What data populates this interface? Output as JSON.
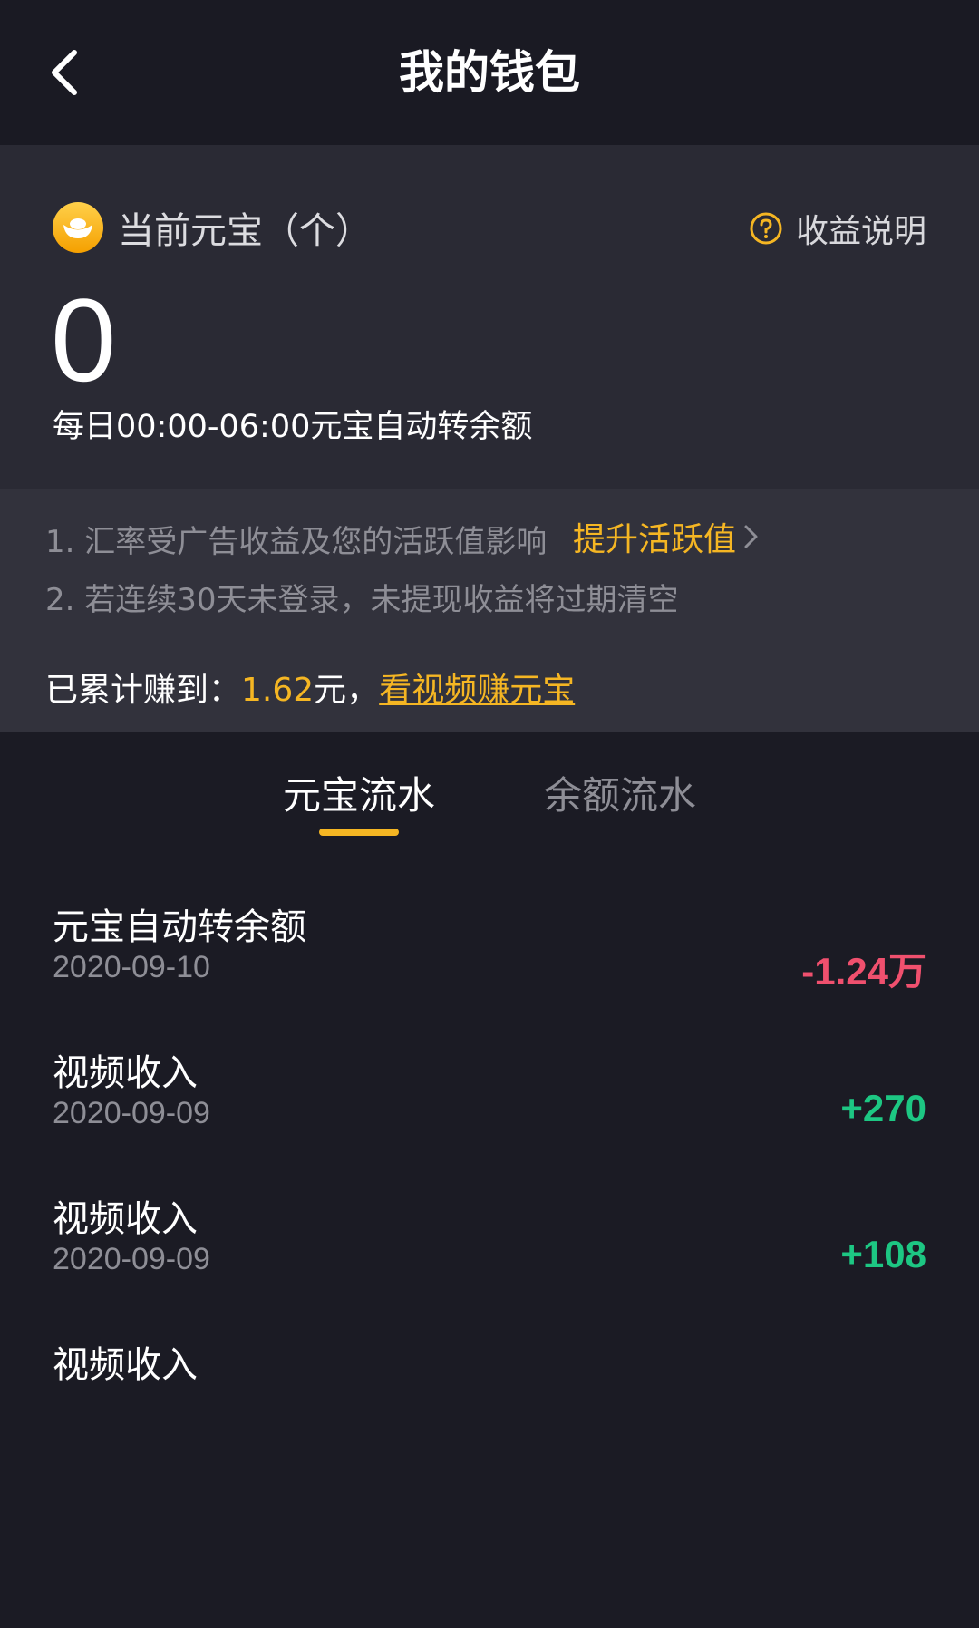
{
  "header": {
    "title": "我的钱包",
    "back_icon": "chevron-left-icon"
  },
  "balance": {
    "coin_icon": "gold-ingot-icon",
    "label": "当前元宝（个）",
    "help_label": "收益说明",
    "help_icon": "question-circle-icon",
    "value": "0",
    "auto_note": "每日00:00-06:00元宝自动转余额"
  },
  "notice": {
    "line1": "1. 汇率受广告收益及您的活跃值影响",
    "boost_label": "提升活跃值",
    "line2": "2. 若连续30天未登录，未提现收益将过期清空",
    "earned_prefix": "已累计赚到：",
    "earned_amount": "1.62",
    "earned_suffix": "元，",
    "earn_link": "看视频赚元宝"
  },
  "tabs": [
    {
      "label": "元宝流水",
      "active": true
    },
    {
      "label": "余额流水",
      "active": false
    }
  ],
  "transactions": [
    {
      "title": "元宝自动转余额",
      "date": "2020-09-10",
      "amount": "-1.24万",
      "type": "negative"
    },
    {
      "title": "视频收入",
      "date": "2020-09-09",
      "amount": "+270",
      "type": "positive"
    },
    {
      "title": "视频收入",
      "date": "2020-09-09",
      "amount": "+108",
      "type": "positive"
    },
    {
      "title": "视频收入",
      "date": "",
      "amount": "",
      "type": "positive"
    }
  ],
  "colors": {
    "accent": "#f5b623",
    "negative": "#f0506e",
    "positive": "#1dc783",
    "background": "#1b1b24"
  }
}
